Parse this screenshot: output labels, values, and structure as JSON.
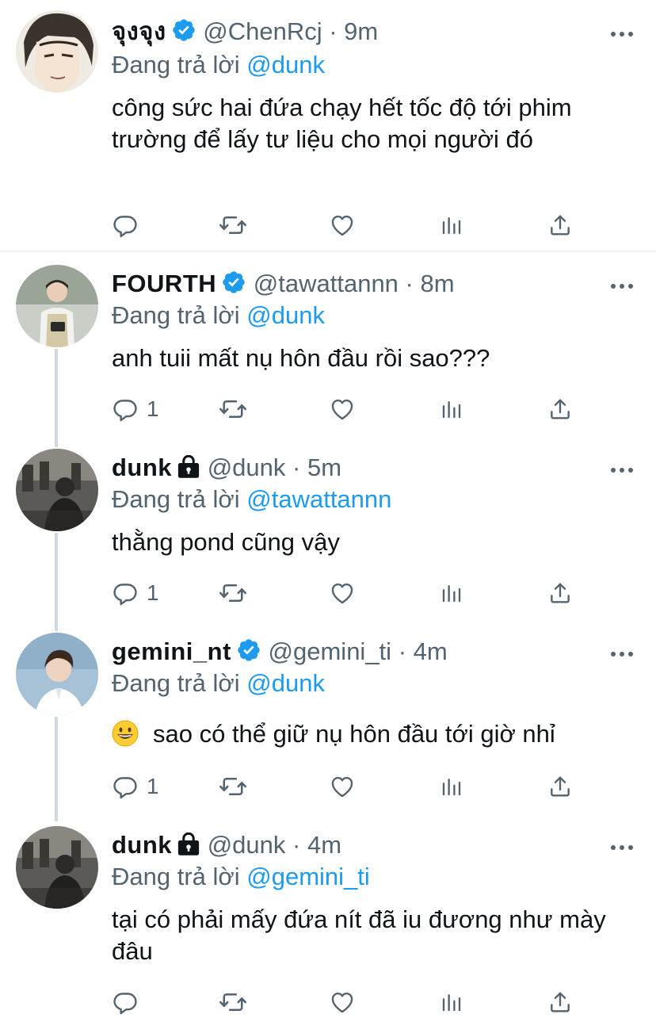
{
  "colors": {
    "accent": "#1d9bf0",
    "muted": "#536471",
    "text": "#0f1419",
    "thread": "#cfd9de"
  },
  "replying_prefix": "Đang trả lời",
  "tweets": [
    {
      "display_name": "จุงจุง",
      "verified": true,
      "handle": "@ChenRcj",
      "dot": "·",
      "time": "9m",
      "reply_to": "@dunk",
      "text": "công sức hai đứa chạy hết tốc độ tới phim trường để lấy tư liệu cho mọi người đó",
      "reply_count": ""
    },
    {
      "display_name": "FOURTH",
      "verified": true,
      "handle": "@tawattannn",
      "dot": "·",
      "time": "8m",
      "reply_to": "@dunk",
      "text": "anh tuii mất nụ hôn đầu rồi sao???",
      "reply_count": "1"
    },
    {
      "display_name": "dunk",
      "locked": true,
      "handle": "@dunk",
      "dot": "·",
      "time": "5m",
      "reply_to": "@tawattannn",
      "text": "thằng pond cũng vậy",
      "reply_count": "1"
    },
    {
      "display_name": "gemini_nt",
      "verified": true,
      "handle": "@gemini_ti",
      "dot": "·",
      "time": "4m",
      "reply_to": "@dunk",
      "emoji": "grinning-face-emoji",
      "text": "sao có thể giữ nụ hôn đầu tới giờ nhỉ",
      "reply_count": "1"
    },
    {
      "display_name": "dunk",
      "locked": true,
      "handle": "@dunk",
      "dot": "·",
      "time": "4m",
      "reply_to": "@gemini_ti",
      "text": "tại có phải mấy đứa nít đã iu đương như mày đâu",
      "reply_count": ""
    }
  ],
  "icons": [
    "reply-icon",
    "retweet-icon",
    "like-icon",
    "analytics-icon",
    "share-icon",
    "more-icon",
    "verified-badge-icon",
    "lock-icon"
  ]
}
